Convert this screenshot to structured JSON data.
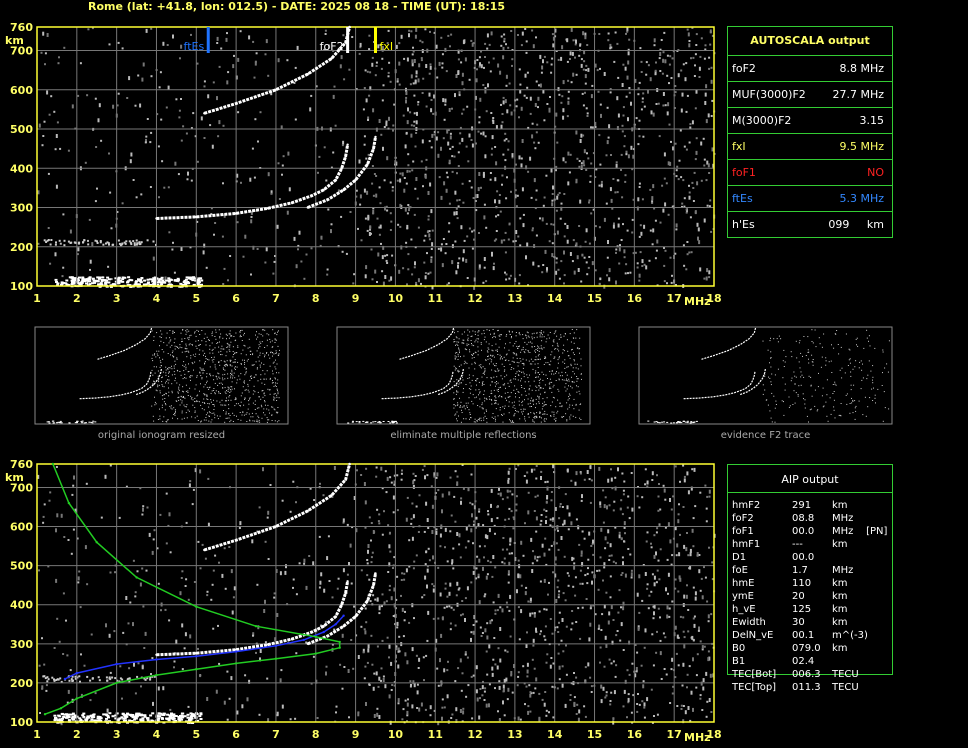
{
  "header": "Rome (lat: +41.8, lon: 012.5) - DATE: 2025 08 18 - TIME (UT): 18:15",
  "chart_data": [
    {
      "type": "scatter",
      "title": "",
      "xlabel": "MHz",
      "ylabel": "km",
      "xlim": [
        1,
        18
      ],
      "ylim": [
        100,
        760
      ],
      "x_ticks": [
        1,
        2,
        3,
        4,
        5,
        6,
        7,
        8,
        9,
        10,
        11,
        12,
        13,
        14,
        15,
        16,
        17,
        18
      ],
      "y_ticks": [
        100,
        200,
        300,
        400,
        500,
        600,
        700,
        760
      ],
      "grid": true,
      "markers": [
        {
          "label": "ftEs",
          "x": 5.3,
          "color": "#1e73ff"
        },
        {
          "label": "foF2",
          "x": 8.8,
          "color": "#ffffff"
        },
        {
          "label": "fxI",
          "x": 9.5,
          "color": "#ffff00"
        }
      ],
      "series": [
        {
          "color": "#ffffff",
          "points": [
            [
              4.0,
              272
            ],
            [
              5.0,
              276
            ],
            [
              6.0,
              285
            ],
            [
              6.8,
              298
            ],
            [
              7.4,
              312
            ],
            [
              7.9,
              330
            ],
            [
              8.2,
              345
            ],
            [
              8.5,
              370
            ],
            [
              8.65,
              400
            ],
            [
              8.75,
              430
            ],
            [
              8.8,
              460
            ]
          ]
        },
        {
          "color": "#ffffff",
          "points": [
            [
              7.8,
              300
            ],
            [
              8.3,
              320
            ],
            [
              8.7,
              345
            ],
            [
              9.0,
              370
            ],
            [
              9.3,
              410
            ],
            [
              9.45,
              450
            ],
            [
              9.5,
              480
            ]
          ]
        },
        {
          "color": "#ffffff",
          "points": [
            [
              5.2,
              540
            ],
            [
              6.0,
              565
            ],
            [
              7.0,
              600
            ],
            [
              7.8,
              640
            ],
            [
              8.4,
              680
            ],
            [
              8.75,
              720
            ],
            [
              8.85,
              760
            ]
          ]
        }
      ]
    },
    {
      "type": "scatter",
      "title": "",
      "xlabel": "MHz",
      "ylabel": "km",
      "xlim": [
        1,
        18
      ],
      "ylim": [
        100,
        760
      ],
      "x_ticks": [
        1,
        2,
        3,
        4,
        5,
        6,
        7,
        8,
        9,
        10,
        11,
        12,
        13,
        14,
        15,
        16,
        17,
        18
      ],
      "y_ticks": [
        100,
        200,
        300,
        400,
        500,
        600,
        700,
        760
      ],
      "grid": true,
      "series": [
        {
          "color": "#ffffff",
          "points": [
            [
              4.0,
              272
            ],
            [
              5.0,
              276
            ],
            [
              6.0,
              285
            ],
            [
              6.8,
              298
            ],
            [
              7.4,
              312
            ],
            [
              7.9,
              330
            ],
            [
              8.2,
              345
            ],
            [
              8.5,
              370
            ],
            [
              8.65,
              400
            ],
            [
              8.75,
              430
            ],
            [
              8.8,
              460
            ]
          ]
        },
        {
          "color": "#ffffff",
          "points": [
            [
              7.8,
              300
            ],
            [
              8.3,
              320
            ],
            [
              8.7,
              345
            ],
            [
              9.0,
              370
            ],
            [
              9.3,
              410
            ],
            [
              9.45,
              450
            ],
            [
              9.5,
              480
            ]
          ]
        },
        {
          "color": "#ffffff",
          "points": [
            [
              5.2,
              540
            ],
            [
              6.0,
              565
            ],
            [
              7.0,
              600
            ],
            [
              7.8,
              640
            ],
            [
              8.4,
              680
            ],
            [
              8.75,
              720
            ],
            [
              8.85,
              760
            ]
          ]
        },
        {
          "color": "#2233ff",
          "points": [
            [
              1.7,
              210
            ],
            [
              2.0,
              225
            ],
            [
              3.0,
              248
            ],
            [
              4.0,
              260
            ],
            [
              5.0,
              268
            ],
            [
              6.0,
              280
            ],
            [
              7.0,
              295
            ],
            [
              7.7,
              310
            ],
            [
              8.2,
              330
            ],
            [
              8.5,
              350
            ],
            [
              8.7,
              372
            ]
          ]
        },
        {
          "color": "#22cc22",
          "points": [
            [
              1.2,
              120
            ],
            [
              1.6,
              135
            ],
            [
              2.0,
              160
            ],
            [
              3.0,
              200
            ],
            [
              4.0,
              220
            ],
            [
              5.0,
              235
            ],
            [
              6.0,
              250
            ],
            [
              7.0,
              262
            ],
            [
              8.0,
              275
            ],
            [
              8.6,
              290
            ],
            [
              8.6,
              305
            ],
            [
              8.0,
              318
            ],
            [
              6.5,
              345
            ],
            [
              5.0,
              395
            ],
            [
              3.5,
              470
            ],
            [
              2.5,
              560
            ],
            [
              1.8,
              660
            ],
            [
              1.4,
              760
            ]
          ]
        }
      ]
    }
  ],
  "thumbnails": [
    {
      "caption": "original ionogram resized"
    },
    {
      "caption": "eliminate multiple reflections"
    },
    {
      "caption": "evidence F2 trace"
    }
  ],
  "autoscala": {
    "title": "AUTOSCALA output",
    "rows": [
      {
        "name": "foF2",
        "value": "8.8 MHz",
        "color": "#ffffff"
      },
      {
        "name": "MUF(3000)F2",
        "value": "27.7 MHz",
        "color": "#ffffff"
      },
      {
        "name": "M(3000)F2",
        "value": "3.15",
        "color": "#ffffff"
      },
      {
        "name": "fxI",
        "value": "9.5 MHz",
        "color": "#ffff66"
      },
      {
        "name": "foF1",
        "value": "NO",
        "color": "#ff2222"
      },
      {
        "name": "ftEs",
        "value": "5.3 MHz",
        "color": "#3388ff"
      },
      {
        "name": "h'Es",
        "value": "099     km",
        "color": "#ffffff"
      }
    ]
  },
  "aip": {
    "title": "AIP output",
    "rows": [
      {
        "name": "hmF2",
        "value": "291",
        "unit": "km"
      },
      {
        "name": "foF2",
        "value": "08.8",
        "unit": "MHz"
      },
      {
        "name": "foF1",
        "value": "00.0",
        "unit": "MHz    [PN]"
      },
      {
        "name": "hmF1",
        "value": "---",
        "unit": "km"
      },
      {
        "name": "D1",
        "value": "00.0",
        "unit": ""
      },
      {
        "name": "foE",
        "value": "1.7",
        "unit": "MHz"
      },
      {
        "name": "hmE",
        "value": "110",
        "unit": "km"
      },
      {
        "name": "ymE",
        "value": "20",
        "unit": "km"
      },
      {
        "name": "h_vE",
        "value": "125",
        "unit": "km"
      },
      {
        "name": "Ewidth",
        "value": "30",
        "unit": "km"
      },
      {
        "name": "DelN_vE",
        "value": "00.1",
        "unit": "m^(-3)"
      },
      {
        "name": "B0",
        "value": "079.0",
        "unit": "km"
      },
      {
        "name": "B1",
        "value": "02.4",
        "unit": ""
      },
      {
        "name": "TEC[Bot]",
        "value": "006.3",
        "unit": "TECU"
      },
      {
        "name": "TEC[Top]",
        "value": "011.3",
        "unit": "TECU"
      }
    ]
  }
}
